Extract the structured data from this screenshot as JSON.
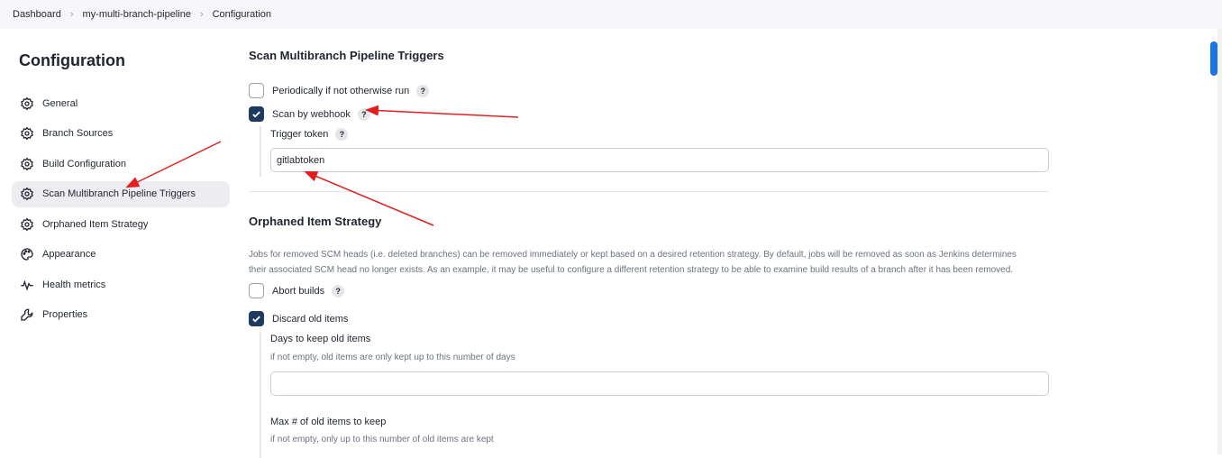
{
  "breadcrumb": [
    "Dashboard",
    "my-multi-branch-pipeline",
    "Configuration"
  ],
  "sidebar": {
    "title": "Configuration",
    "items": [
      {
        "label": "General",
        "icon": "gear-icon"
      },
      {
        "label": "Branch Sources",
        "icon": "gear-icon"
      },
      {
        "label": "Build Configuration",
        "icon": "gear-icon"
      },
      {
        "label": "Scan Multibranch Pipeline Triggers",
        "icon": "gear-icon",
        "active": true
      },
      {
        "label": "Orphaned Item Strategy",
        "icon": "gear-icon"
      },
      {
        "label": "Appearance",
        "icon": "palette-icon"
      },
      {
        "label": "Health metrics",
        "icon": "pulse-icon"
      },
      {
        "label": "Properties",
        "icon": "wrench-icon"
      }
    ]
  },
  "triggers": {
    "title": "Scan Multibranch Pipeline Triggers",
    "periodic_label": "Periodically if not otherwise run",
    "periodic_checked": false,
    "webhook_label": "Scan by webhook",
    "webhook_checked": true,
    "token_label": "Trigger token",
    "token_value": "gitlabtoken",
    "help": "?"
  },
  "orphaned": {
    "title": "Orphaned Item Strategy",
    "description_line1": "Jobs for removed SCM heads (i.e. deleted branches) can be removed immediately or kept based on a desired retention strategy. By default, jobs will be removed as soon as Jenkins determines",
    "description_line2": "their associated SCM head no longer exists. As an example, it may be useful to configure a different retention strategy to be able to examine build results of a branch after it has been removed.",
    "abort_label": "Abort builds",
    "abort_checked": false,
    "discard_label": "Discard old items",
    "discard_checked": true,
    "days_label": "Days to keep old items",
    "days_hint": "if not empty, old items are only kept up to this number of days",
    "days_value": "",
    "max_label": "Max # of old items to keep",
    "max_hint": "if not empty, only up to this number of old items are kept",
    "help": "?"
  },
  "colors": {
    "accent": "#1e3a5f",
    "annotation_arrow": "#e02020",
    "scrollbar": "#1a73e8"
  }
}
